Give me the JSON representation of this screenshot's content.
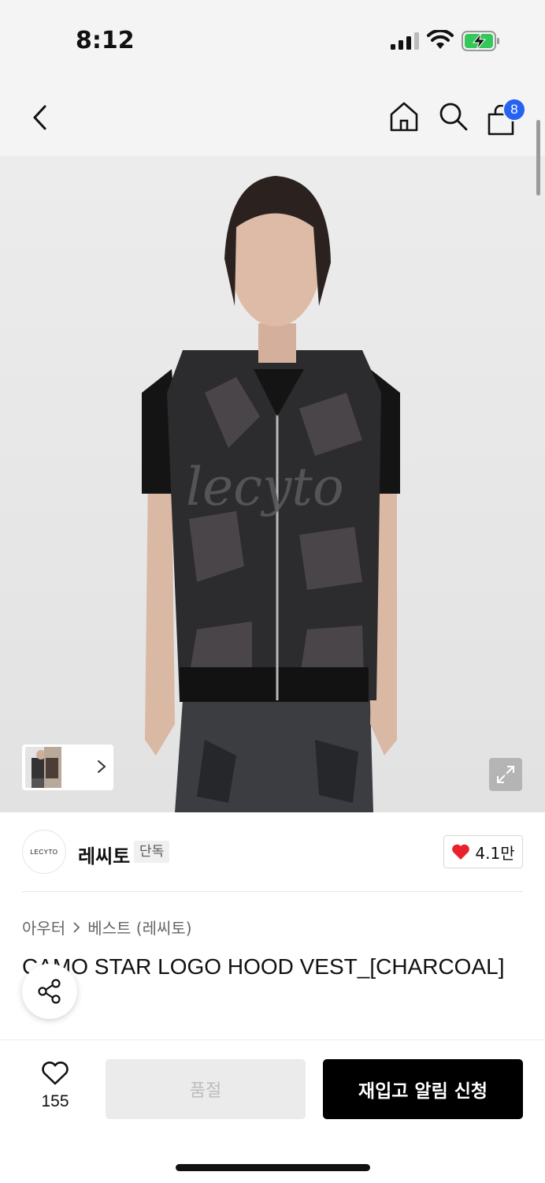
{
  "status_bar": {
    "time": "8:12",
    "icons": [
      "signal-icon",
      "wifi-icon",
      "battery-charging-icon"
    ]
  },
  "nav": {
    "icons": [
      "back-icon",
      "home-icon",
      "search-icon",
      "shopping-bag-icon"
    ],
    "cart_count": "8",
    "accent_color": "#2563f0"
  },
  "gallery": {
    "icons": [
      "chevron-right-icon",
      "expand-icon"
    ]
  },
  "brand": {
    "logo_text": "LECYTO",
    "name": "레씨토",
    "badge": "단독",
    "like_count": "4.1만",
    "heart_color": "#e8212b"
  },
  "product": {
    "breadcrumb": [
      "아우터",
      "베스트 (레씨토)"
    ],
    "title": "CAMO STAR LOGO HOOD VEST_[CHARCOAL]"
  },
  "bottom_bar": {
    "wish_count": "155",
    "soldout_label": "품절",
    "restock_label": "재입고 알림 신청"
  }
}
